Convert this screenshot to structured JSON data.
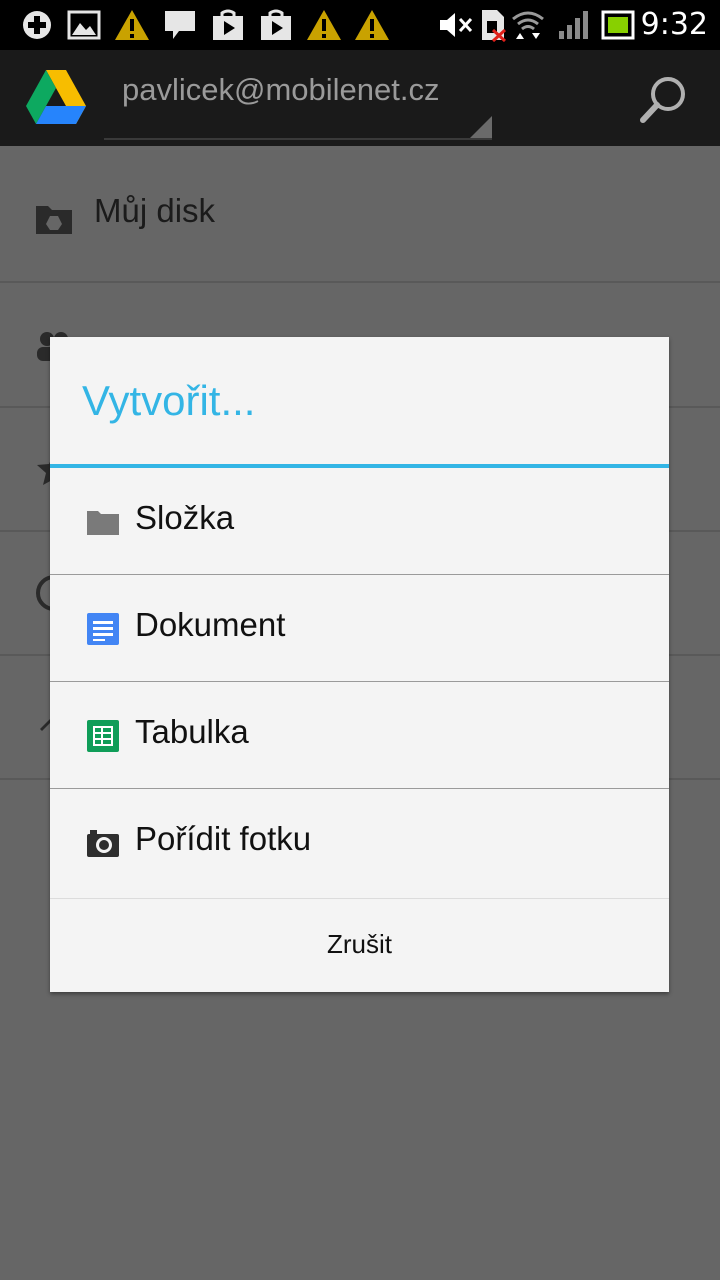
{
  "status_bar": {
    "time": "9:32",
    "left_icons": [
      "add-icon",
      "image-icon",
      "warning-icon",
      "chat-icon",
      "play-store-icon",
      "play-store-icon",
      "warning-icon",
      "warning-icon"
    ],
    "right_icons": [
      "mute-icon",
      "no-sim-icon",
      "wifi-icon",
      "signal-icon",
      "battery-icon"
    ]
  },
  "action_bar": {
    "account": "pavlicek@mobilenet.cz",
    "search_icon": "search-icon",
    "logo_icon": "google-drive-logo"
  },
  "nav": {
    "items": [
      {
        "label": "Můj disk",
        "icon": "drive-folder-icon"
      },
      {
        "label": "",
        "icon": "shared-icon"
      },
      {
        "label": "",
        "icon": "star-icon"
      },
      {
        "label": "",
        "icon": "recent-icon"
      },
      {
        "label": "",
        "icon": "offline-icon"
      }
    ]
  },
  "dialog": {
    "title": "Vytvořit...",
    "accent_color": "#33b5e5",
    "options": [
      {
        "label": "Složka",
        "icon": "folder-icon"
      },
      {
        "label": "Dokument",
        "icon": "document-icon"
      },
      {
        "label": "Tabulka",
        "icon": "spreadsheet-icon"
      },
      {
        "label": "Pořídit fotku",
        "icon": "camera-icon"
      }
    ],
    "cancel_label": "Zrušit"
  },
  "colors": {
    "doc_blue": "#4285f4",
    "sheet_green": "#0f9d58",
    "overlay_gray": "#666666"
  }
}
